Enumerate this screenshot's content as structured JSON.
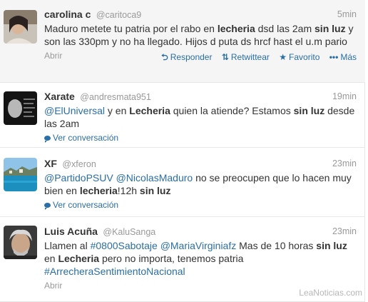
{
  "tweets": [
    {
      "fullname": "carolina c",
      "username": "@caritoca9",
      "time": "5min",
      "text": [
        {
          "t": "Maduro metete tu patria por el rabo en "
        },
        {
          "t": "lecheria",
          "b": true
        },
        {
          "t": " dsd las 2am "
        },
        {
          "t": "sin luz",
          "b": true
        },
        {
          "t": " y son las 330pm y no ha llegado. Hijos d puta ds hrcf hast el u.m pario"
        }
      ],
      "footer_link": "Abrir",
      "actions": {
        "reply": "Responder",
        "retweet": "Retwittear",
        "favorite": "Favorito",
        "more": "Más"
      }
    },
    {
      "fullname": "Xarate",
      "username": "@andresmata951",
      "time": "19min",
      "text": [
        {
          "t": "@ElUniversal",
          "l": true
        },
        {
          "t": " y en "
        },
        {
          "t": "Lecheria",
          "b": true
        },
        {
          "t": " quien la atiende? Estamos "
        },
        {
          "t": "sin luz",
          "b": true
        },
        {
          "t": " desde las 2am"
        }
      ],
      "footer_link": "Ver conversación"
    },
    {
      "fullname": "XF",
      "username": "@xferon",
      "time": "23min",
      "text": [
        {
          "t": "@PartidoPSUV",
          "l": true
        },
        {
          "t": " "
        },
        {
          "t": "@NicolasMaduro",
          "l": true
        },
        {
          "t": " no se preocupen que lo hacen muy bien en "
        },
        {
          "t": "lecheria",
          "b": true
        },
        {
          "t": "!12h "
        },
        {
          "t": "sin luz",
          "b": true
        }
      ],
      "footer_link": "Ver conversación"
    },
    {
      "fullname": "Luis Acuña",
      "username": "@KaluSanga",
      "time": "23min",
      "text": [
        {
          "t": "Llamen al "
        },
        {
          "t": "#0800Sabotaje",
          "l": true
        },
        {
          "t": " "
        },
        {
          "t": "@MariaVirginiafz",
          "l": true
        },
        {
          "t": "  Mas de 10 horas "
        },
        {
          "t": "sin luz",
          "b": true
        },
        {
          "t": " en "
        },
        {
          "t": "Lecheria",
          "b": true
        },
        {
          "t": " pero no importa, tenemos patria "
        },
        {
          "t": "#ArrecheraSentimientoNacional",
          "l": true
        }
      ],
      "footer_link": "Abrir"
    }
  ],
  "watermark": "LeaNoticias.com",
  "icons": {
    "reply": "reply-arrow-icon",
    "retweet": "retweet-icon",
    "favorite": "star-icon",
    "more": "ellipsis-icon",
    "conversation": "speech-bubble-icon"
  },
  "colors": {
    "link": "#2a6ea6",
    "meta": "#999999",
    "text": "#333333",
    "highlight_bg": "#f5f5f5"
  }
}
